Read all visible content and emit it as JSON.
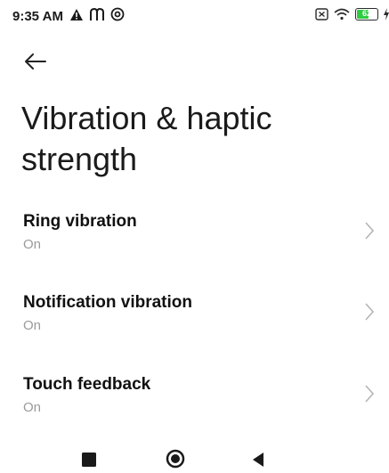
{
  "status_bar": {
    "time": "9:35 AM",
    "battery_level": "62",
    "icons_left": [
      "warning-icon",
      "m-app-icon",
      "at-sign-icon"
    ],
    "icons_right": [
      "sim-off-icon",
      "wifi-icon",
      "battery-icon",
      "charging-icon"
    ]
  },
  "header": {
    "back_icon": "arrow-left-icon",
    "title": "Vibration & haptic strength"
  },
  "settings": [
    {
      "label": "Ring vibration",
      "value": "On"
    },
    {
      "label": "Notification vibration",
      "value": "On"
    },
    {
      "label": "Touch feedback",
      "value": "On"
    }
  ],
  "nav_bar": {
    "buttons": [
      "recents-square-icon",
      "home-circle-icon",
      "back-triangle-icon"
    ]
  },
  "colors": {
    "background": "#ffffff",
    "battery_fill": "#2ecc40",
    "secondary_text": "#9a9a9a",
    "chevron": "#b5b5b5"
  }
}
